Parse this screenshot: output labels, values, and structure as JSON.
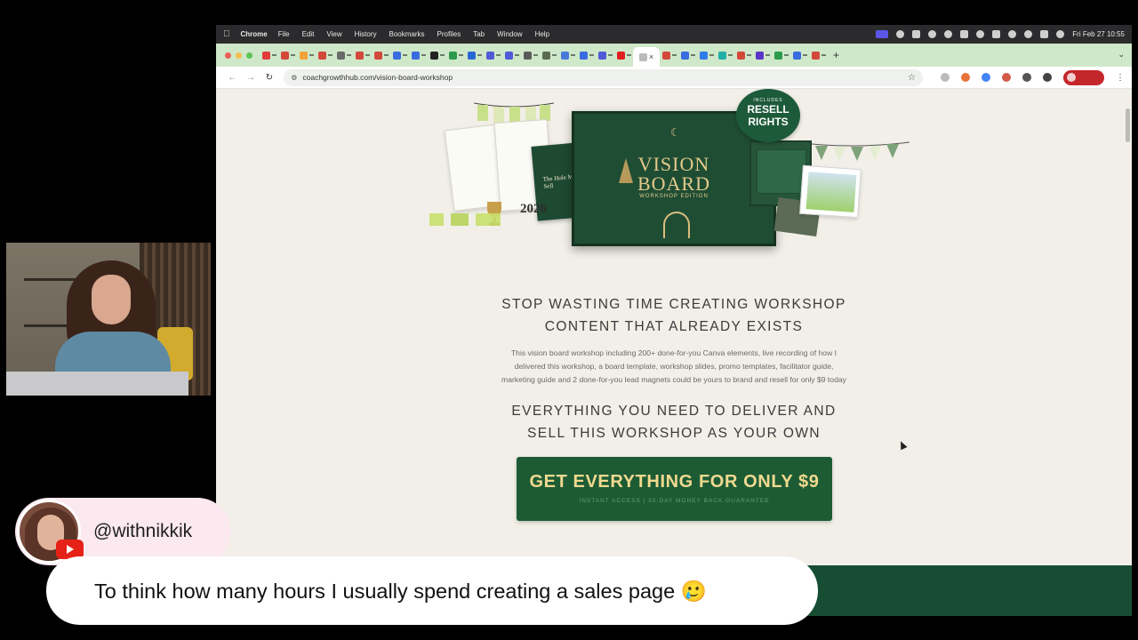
{
  "menubar": {
    "app_name": "Chrome",
    "menus": [
      "File",
      "Edit",
      "View",
      "History",
      "Bookmarks",
      "Profiles",
      "Tab",
      "Window",
      "Help"
    ],
    "datetime": "Fri Feb 27  10:55"
  },
  "tabstrip": {
    "tab_favicon_colors": [
      "#e23c3c",
      "#d4483a",
      "#f0a23a",
      "#d4483a",
      "#6a6a6a",
      "#d4483a",
      "#d4483a",
      "#3a6be0",
      "#3a6be0",
      "#222222",
      "#2b9a4a",
      "#2866d6",
      "#4e5ad8",
      "#4e5ad8",
      "#5a5a5a",
      "#5b6b50",
      "#4a7ad8",
      "#3a6be0",
      "#4e5ad8",
      "#e02020",
      "#d4483a",
      "#3a6be0",
      "#2f7be8",
      "#21b0a8",
      "#d4483a",
      "#5b35c8",
      "#2b9a4a",
      "#3a6be0",
      "#d4483a"
    ],
    "active_tab_close": "×",
    "new_tab": "+",
    "tab_menu": "⌄"
  },
  "toolbar": {
    "url": "coachgrowthhub.com/vision-board-workshop"
  },
  "page": {
    "badge_top": "INCLUDES",
    "badge_line1": "RESELL",
    "badge_line2": "RIGHTS",
    "board_line1": "VISION",
    "board_line2": "BOARD",
    "board_edition": "WORKSHOP EDITION",
    "book_title": "The Hole Model Sell",
    "year": "2026",
    "headline1_line1": "STOP WASTING TIME CREATING WORKSHOP",
    "headline1_line2": "CONTENT THAT ALREADY EXISTS",
    "body_line1": "This vision board workshop including 200+ done-for-you Canva elements, live recording of how I",
    "body_line2": "delivered this workshop, a board template, workshop slides, promo templates, facilitator guide,",
    "body_line3": "marketing guide and 2 done-for-you lead magnets could be yours to brand and resell for only $9 today",
    "headline2_line1": "EVERYTHING YOU NEED TO DELIVER AND",
    "headline2_line2": "SELL THIS WORKSHOP AS YOUR OWN",
    "cta_label": "GET EVERYTHING FOR ONLY $9",
    "cta_sub": "INSTANT ACCESS  |  30-DAY MONEY BACK GUARANTEE"
  },
  "overlay": {
    "handle": "@withnikkik",
    "caption": "To think how many hours I usually spend creating a sales page 🥲"
  }
}
